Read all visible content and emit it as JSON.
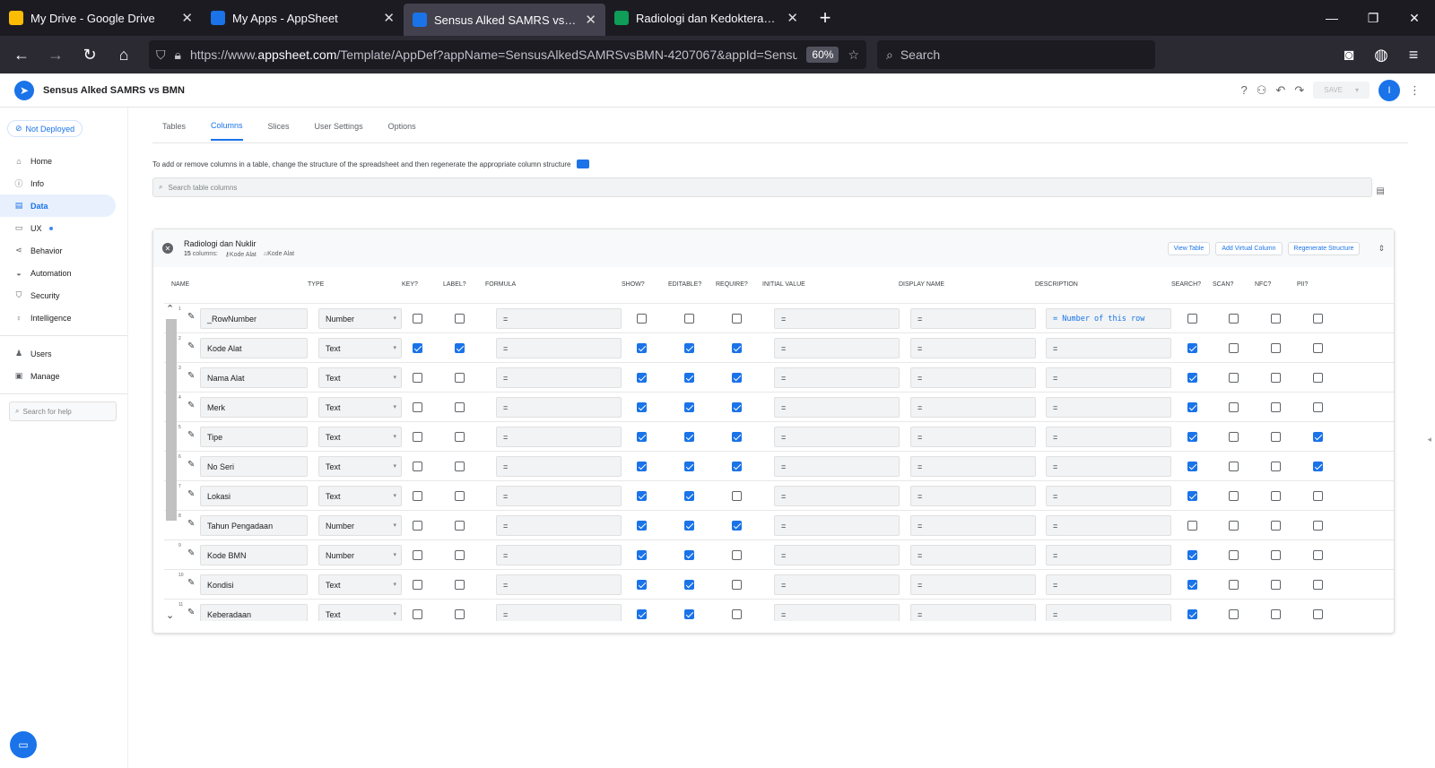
{
  "browser": {
    "tabs": [
      {
        "title": "My Drive - Google Drive",
        "color": "#fbbc04"
      },
      {
        "title": "My Apps - AppSheet",
        "color": "#1a73e8"
      },
      {
        "title": "Sensus Alked SAMRS vs BMN - A",
        "color": "#1a73e8",
        "active": true
      },
      {
        "title": "Radiologi dan Kedokteran Nukli",
        "color": "#0f9d58"
      }
    ],
    "url_prefix": "https://www.",
    "url_domain": "appsheet.com",
    "url_rest": "/Template/AppDef?appName=SensusAlkedSAMRSvsBMN-4207067&appId=SensusA",
    "zoom": "60%",
    "search_placeholder": "Search"
  },
  "app": {
    "name": "Sensus Alked SAMRS vs BMN",
    "save": "SAVE",
    "avatar": "I"
  },
  "sidebar": {
    "deploy": "Not Deployed",
    "items": [
      {
        "label": "Home",
        "icon": "home-icon",
        "glyph": "⌂"
      },
      {
        "label": "Info",
        "icon": "info-icon",
        "glyph": "ⓘ"
      },
      {
        "label": "Data",
        "icon": "data-icon",
        "glyph": "▤",
        "active": true
      },
      {
        "label": "UX",
        "icon": "ux-icon",
        "glyph": "▭",
        "dot": true
      },
      {
        "label": "Behavior",
        "icon": "behavior-icon",
        "glyph": "⋖"
      },
      {
        "label": "Automation",
        "icon": "automation-icon",
        "glyph": "◒"
      },
      {
        "label": "Security",
        "icon": "security-icon",
        "glyph": "⛉"
      },
      {
        "label": "Intelligence",
        "icon": "intelligence-icon",
        "glyph": "♀"
      }
    ],
    "items2": [
      {
        "label": "Users",
        "icon": "users-icon",
        "glyph": "♟"
      },
      {
        "label": "Manage",
        "icon": "manage-icon",
        "glyph": "▣"
      }
    ],
    "help_placeholder": "Search for help"
  },
  "main": {
    "tabs": [
      "Tables",
      "Columns",
      "Slices",
      "User Settings",
      "Options"
    ],
    "active_tab": 1,
    "hint": "To add or remove columns in a table, change the structure of the spreadsheet and then regenerate the appropriate column structure",
    "search_placeholder": "Search table columns"
  },
  "table": {
    "name": "Radiologi dan Nuklir",
    "count": "15",
    "count_label": "columns:",
    "key_tag": "Kode Alat",
    "label_tag": "Kode Alat",
    "buttons": [
      "View Table",
      "Add Virtual Column",
      "Regenerate Structure"
    ],
    "headers": [
      "NAME",
      "TYPE",
      "KEY?",
      "LABEL?",
      "FORMULA",
      "SHOW?",
      "EDITABLE?",
      "REQUIRE?",
      "INITIAL VALUE",
      "DISPLAY NAME",
      "DESCRIPTION",
      "SEARCH?",
      "SCAN?",
      "NFC?",
      "PII?"
    ],
    "rows": [
      {
        "n": "1",
        "name": "_RowNumber",
        "type": "Number",
        "key": false,
        "label": false,
        "formula": "=",
        "show": false,
        "edit": false,
        "req": false,
        "init": "=",
        "disp": "=",
        "desc": "= Number of this row",
        "search": false,
        "scan": false,
        "nfc": false,
        "pii": false
      },
      {
        "n": "2",
        "name": "Kode Alat",
        "type": "Text",
        "key": true,
        "label": true,
        "formula": "=",
        "show": true,
        "edit": true,
        "req": true,
        "init": "=",
        "disp": "=",
        "desc": "=",
        "search": true,
        "scan": false,
        "nfc": false,
        "pii": false
      },
      {
        "n": "3",
        "name": "Nama Alat",
        "type": "Text",
        "key": false,
        "label": false,
        "formula": "=",
        "show": true,
        "edit": true,
        "req": true,
        "init": "=",
        "disp": "=",
        "desc": "=",
        "search": true,
        "scan": false,
        "nfc": false,
        "pii": false
      },
      {
        "n": "4",
        "name": "Merk",
        "type": "Text",
        "key": false,
        "label": false,
        "formula": "=",
        "show": true,
        "edit": true,
        "req": true,
        "init": "=",
        "disp": "=",
        "desc": "=",
        "search": true,
        "scan": false,
        "nfc": false,
        "pii": false
      },
      {
        "n": "5",
        "name": "Tipe",
        "type": "Text",
        "key": false,
        "label": false,
        "formula": "=",
        "show": true,
        "edit": true,
        "req": true,
        "init": "=",
        "disp": "=",
        "desc": "=",
        "search": true,
        "scan": false,
        "nfc": false,
        "pii": true
      },
      {
        "n": "6",
        "name": "No Seri",
        "type": "Text",
        "key": false,
        "label": false,
        "formula": "=",
        "show": true,
        "edit": true,
        "req": true,
        "init": "=",
        "disp": "=",
        "desc": "=",
        "search": true,
        "scan": false,
        "nfc": false,
        "pii": true
      },
      {
        "n": "7",
        "name": "Lokasi",
        "type": "Text",
        "key": false,
        "label": false,
        "formula": "=",
        "show": true,
        "edit": true,
        "req": false,
        "init": "=",
        "disp": "=",
        "desc": "=",
        "search": true,
        "scan": false,
        "nfc": false,
        "pii": false
      },
      {
        "n": "8",
        "name": "Tahun Pengadaan",
        "type": "Number",
        "key": false,
        "label": false,
        "formula": "=",
        "show": true,
        "edit": true,
        "req": true,
        "init": "=",
        "disp": "=",
        "desc": "=",
        "search": false,
        "scan": false,
        "nfc": false,
        "pii": false
      },
      {
        "n": "9",
        "name": "Kode BMN",
        "type": "Number",
        "key": false,
        "label": false,
        "formula": "=",
        "show": true,
        "edit": true,
        "req": false,
        "init": "=",
        "disp": "=",
        "desc": "=",
        "search": true,
        "scan": false,
        "nfc": false,
        "pii": false
      },
      {
        "n": "10",
        "name": "Kondisi",
        "type": "Text",
        "key": false,
        "label": false,
        "formula": "=",
        "show": true,
        "edit": true,
        "req": false,
        "init": "=",
        "disp": "=",
        "desc": "=",
        "search": true,
        "scan": false,
        "nfc": false,
        "pii": false
      },
      {
        "n": "11",
        "name": "Keberadaan",
        "type": "Text",
        "key": false,
        "label": false,
        "formula": "=",
        "show": true,
        "edit": true,
        "req": false,
        "init": "=",
        "disp": "=",
        "desc": "=",
        "search": true,
        "scan": false,
        "nfc": false,
        "pii": false
      }
    ]
  }
}
